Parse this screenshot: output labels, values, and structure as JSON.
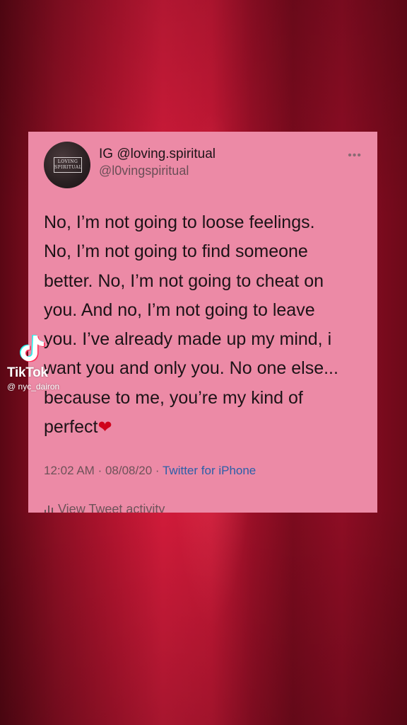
{
  "tweet": {
    "display_name": "IG @loving.spiritual",
    "handle": "@l0vingspiritual",
    "avatar_text_line1": "LOVING",
    "avatar_text_line2": "SPIRITUAL",
    "text": "No, I’m not going to loose feelings.\nNo, I’m not going to find someone\nbetter. No, I’m not going to cheat on\nyou. And no, I’m not going to leave\nyou. I’ve already made up my mind, i\nwant you and only you. No one else...\nbecause to me, you’re my kind of\nperfect",
    "emoji": "❤",
    "time": "12:02 AM",
    "date": "08/08/20",
    "separator": "·",
    "source": "Twitter for iPhone",
    "activity_label": "View Tweet activity",
    "more_icon": "more-options-icon"
  },
  "overlay": {
    "brand": "TikTok",
    "username": "@ nyc_dairon"
  },
  "colors": {
    "card_background": "#ec8aa6",
    "background_red": "#b4142f",
    "link_blue": "#2b5fa8",
    "heart_red": "#d0021b"
  }
}
